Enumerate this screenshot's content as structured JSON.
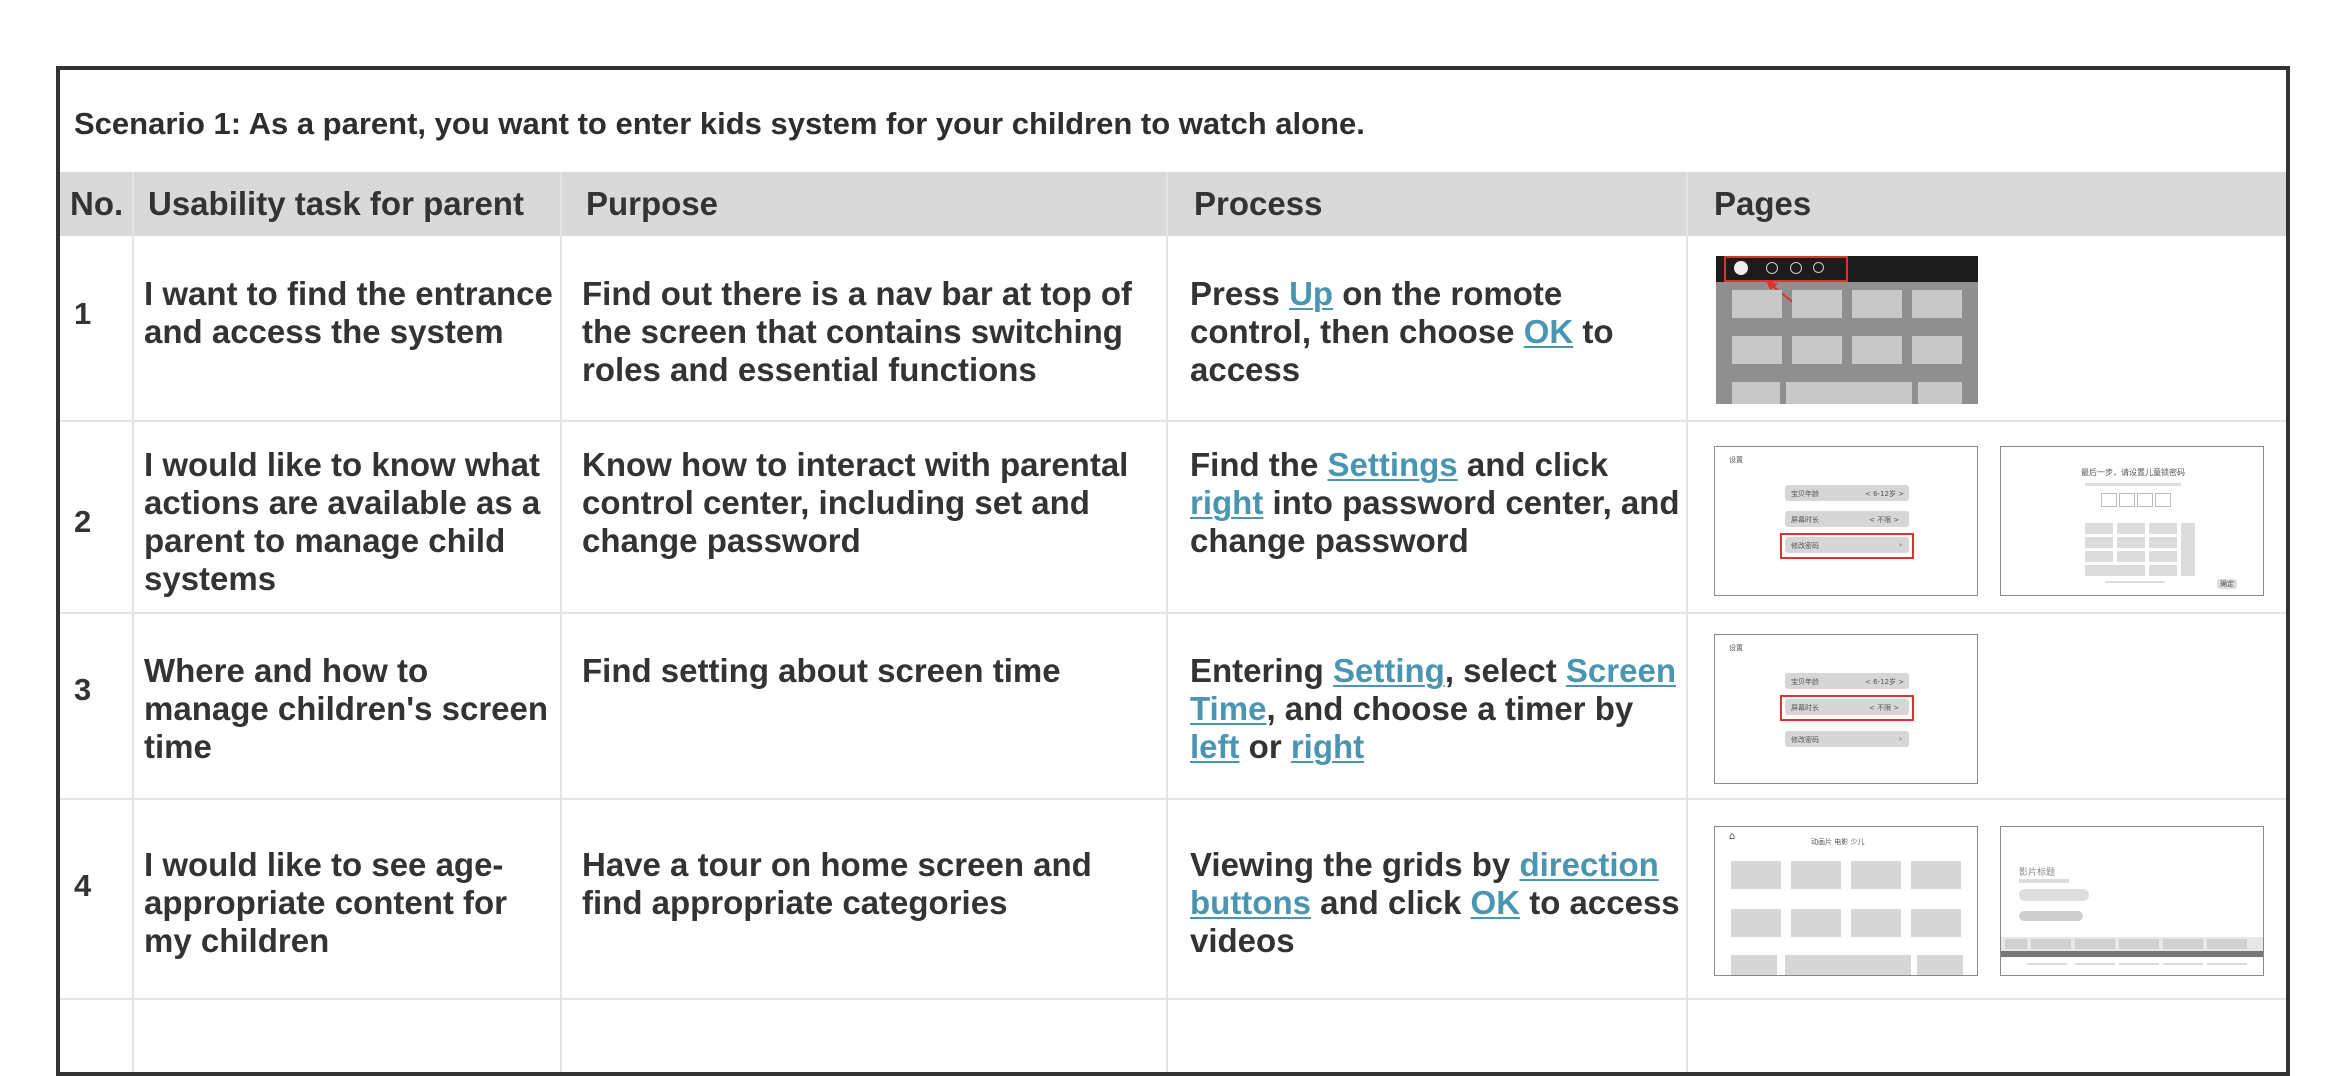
{
  "scenario": {
    "title": "Scenario 1: As a parent, you want to enter kids system for your children to watch alone."
  },
  "columns": {
    "no": "No.",
    "task": "Usability task for parent",
    "purpose": "Purpose",
    "process": "Process",
    "pages": "Pages"
  },
  "rows": [
    {
      "no": "1",
      "task": "I want to find the entrance and access the system",
      "purpose": "Find out there is a nav bar at top of the screen that contains switching roles and essential functions",
      "process": [
        {
          "t": "Press "
        },
        {
          "t": "Up",
          "link": true
        },
        {
          "t": " on the romote control, then choose "
        },
        {
          "t": "OK",
          "link": true
        },
        {
          "t": " to access"
        }
      ]
    },
    {
      "no": "2",
      "task": "I would like to know what actions are available as a parent to manage child systems",
      "purpose": "Know how to interact with parental control center, including set and change password",
      "process": [
        {
          "t": "Find the "
        },
        {
          "t": "Settings",
          "link": true
        },
        {
          "t": " and click "
        },
        {
          "t": "right",
          "link": true
        },
        {
          "t": " into password center, and change password"
        }
      ]
    },
    {
      "no": "3",
      "task": "Where and how to manage children's screen time",
      "purpose": "Find setting about screen time",
      "process": [
        {
          "t": "Entering "
        },
        {
          "t": "Setting",
          "link": true
        },
        {
          "t": ", select "
        },
        {
          "t": "Screen Time",
          "link": true
        },
        {
          "t": ", and choose a timer by "
        },
        {
          "t": "left",
          "link": true
        },
        {
          "t": " or "
        },
        {
          "t": "right",
          "link": true
        }
      ]
    },
    {
      "no": "4",
      "task": "I would like to see age-appropriate content for my children",
      "purpose": "Have a tour on home screen and find appropriate categories",
      "process": [
        {
          "t": "Viewing the grids by "
        },
        {
          "t": "direction buttons",
          "link": true
        },
        {
          "t": " and click "
        },
        {
          "t": "OK",
          "link": true
        },
        {
          "t": " to access videos"
        }
      ]
    }
  ],
  "thumbs": {
    "settings_title": "设置",
    "baby_age": "宝贝年龄",
    "baby_age_val": "< 6-12岁 >",
    "screen_time": "屏幕时长",
    "screen_time_val": "< 不限 >",
    "change_pw": "修改密码",
    "pw_title": "最后一步，请设置儿童锁密码",
    "confirm": "确定",
    "home_tabs": "动画片   电影   少儿",
    "video_title": "影片标题"
  },
  "colors": {
    "link": "#4a96b2",
    "header_bg": "#d9d9d9",
    "highlight": "#e03030"
  }
}
